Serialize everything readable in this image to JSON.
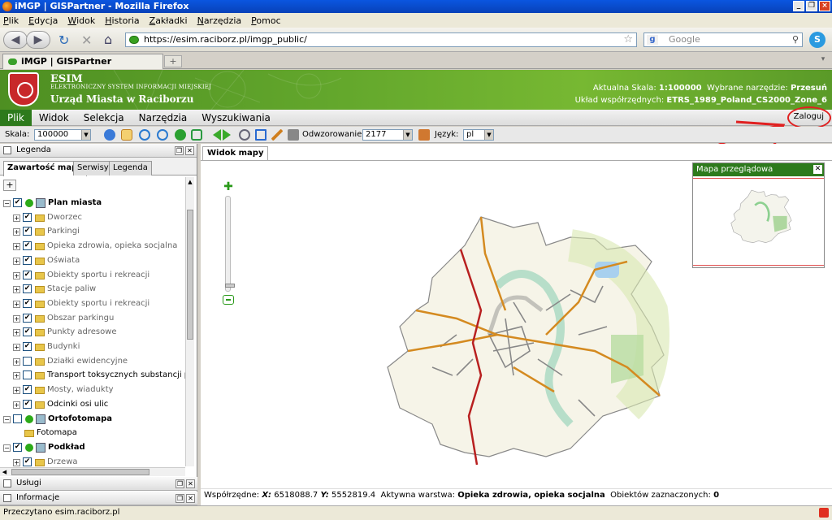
{
  "window": {
    "title": "iMGP | GISPartner - Mozilla Firefox"
  },
  "browser_menu": [
    "Plik",
    "Edycja",
    "Widok",
    "Historia",
    "Zakładki",
    "Narzędzia",
    "Pomoc"
  ],
  "nav": {
    "url": "https://esim.raciborz.pl/imgp_public/",
    "search_placeholder": "Google"
  },
  "tab": {
    "title": "iMGP | GISPartner",
    "new_tab": "+"
  },
  "header": {
    "title": "ESIM",
    "subtitle": "ELEKTRONICZNY SYSTEM INFORMACJI MIEJSKIEJ",
    "org": "Urząd Miasta w Raciborzu",
    "scale_label": "Aktualna Skala:",
    "scale_value": "1:100000",
    "tool_label": "Wybrane narzędzie:",
    "tool_value": "Przesuń",
    "crs_label": "Układ współrzędnych:",
    "crs_value": "ETRS_1989_Poland_CS2000_Zone_6"
  },
  "app_menu": {
    "items": [
      "Plik",
      "Widok",
      "Selekcja",
      "Narzędzia",
      "Wyszukiwania"
    ],
    "active": 0,
    "login": "Zaloguj"
  },
  "toolbar": {
    "scale_label": "Skala:",
    "scale_value": "100000",
    "projection_label": "Odwzorowanie:",
    "projection_value": "2177",
    "language_label": "Język:",
    "language_value": "pl"
  },
  "legend": {
    "title": "Legenda",
    "tabs": [
      "Zawartość mapy",
      "Serwisy",
      "Legenda"
    ],
    "add": "+",
    "layers": [
      {
        "label": "Plan miasta",
        "level": 0,
        "checked": true,
        "bold": true
      },
      {
        "label": "Dworzec",
        "level": 1,
        "checked": true
      },
      {
        "label": "Parkingi",
        "level": 1,
        "checked": true
      },
      {
        "label": "Opieka zdrowia, opieka socjalna",
        "level": 1,
        "checked": true
      },
      {
        "label": "Oświata",
        "level": 1,
        "checked": true
      },
      {
        "label": "Obiekty sportu i rekreacji",
        "level": 1,
        "checked": true
      },
      {
        "label": "Stacje paliw",
        "level": 1,
        "checked": true
      },
      {
        "label": "Obiekty sportu i rekreacji",
        "level": 1,
        "checked": true
      },
      {
        "label": "Obszar parkingu",
        "level": 1,
        "checked": true
      },
      {
        "label": "Punkty adresowe",
        "level": 1,
        "checked": true
      },
      {
        "label": "Budynki",
        "level": 1,
        "checked": true
      },
      {
        "label": "Działki ewidencyjne",
        "level": 1,
        "checked": false
      },
      {
        "label": "Transport toksycznych substancji pods",
        "level": 1,
        "checked": false,
        "dark": true
      },
      {
        "label": "Mosty, wiadukty",
        "level": 1,
        "checked": true
      },
      {
        "label": "Odcinki osi ulic",
        "level": 1,
        "checked": true,
        "dark": true
      },
      {
        "label": "Ortofotomapa",
        "level": 0,
        "checked": false,
        "bold": true
      },
      {
        "label": "Fotomapa",
        "level": 1,
        "leaf": true,
        "dark": true
      },
      {
        "label": "Podkład",
        "level": 0,
        "checked": true,
        "bold": true
      },
      {
        "label": "Drzewa",
        "level": 1,
        "checked": true
      }
    ]
  },
  "panels": {
    "services": "Usługi",
    "info": "Informacje"
  },
  "map": {
    "tab": "Widok mapy",
    "overview_title": "Mapa przeglądowa",
    "status": {
      "coords_label": "Współrzędne:",
      "x_label": "X:",
      "x_value": "6518088.7",
      "y_label": "Y:",
      "y_value": "5552819.4",
      "layer_label": "Aktywna warstwa:",
      "layer_value": "Opieka zdrowia, opieka socjalna",
      "selected_label": "Obiektów zaznaczonych:",
      "selected_value": "0"
    }
  },
  "status_bar": "Przeczytano esim.raciborz.pl",
  "colors": {
    "accent_green": "#2d7a1c",
    "road_orange": "#d48a20",
    "road_red": "#b82020",
    "annotation_red": "#e02020"
  }
}
